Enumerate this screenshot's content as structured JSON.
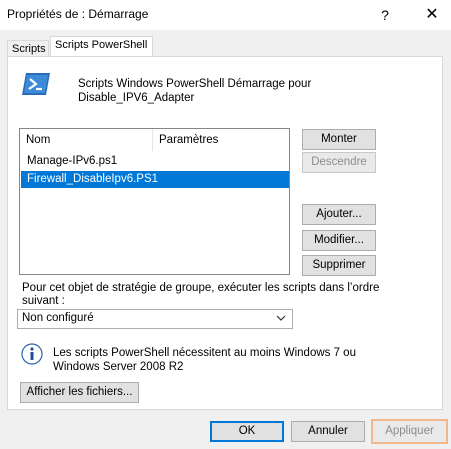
{
  "window": {
    "title": "Propriétés de : Démarrage",
    "help_label": "?",
    "close_label": "✕"
  },
  "tabs": [
    {
      "label": "Scripts"
    },
    {
      "label": "Scripts PowerShell"
    }
  ],
  "header": {
    "icon": "powershell-icon",
    "line1": "Scripts Windows PowerShell Démarrage pour",
    "line2": "Disable_IPV6_Adapter"
  },
  "list": {
    "columns": [
      "Nom",
      "Paramètres"
    ],
    "rows": [
      {
        "name": "Manage-IPv6.ps1",
        "params": ""
      },
      {
        "name": "Firewall_DisableIpv6.PS1",
        "params": ""
      }
    ],
    "selected_index": 1
  },
  "side_buttons": {
    "up": "Monter",
    "down": "Descendre",
    "add": "Ajouter...",
    "edit": "Modifier...",
    "remove": "Supprimer"
  },
  "order": {
    "line1": "Pour cet objet de stratégie de groupe, exécuter les scripts dans l’ordre",
    "line2": "suivant :",
    "select_value": "Non configuré"
  },
  "info": {
    "icon": "info-icon",
    "line1": "Les scripts PowerShell nécessitent au moins Windows 7 ou",
    "line2": "Windows Server 2008 R2",
    "show_files": "Afficher les fichiers..."
  },
  "footer": {
    "ok": "OK",
    "cancel": "Annuler",
    "apply": "Appliquer"
  },
  "colors": {
    "selection": "#0078d7",
    "apply_focus": "#f2b78b"
  }
}
